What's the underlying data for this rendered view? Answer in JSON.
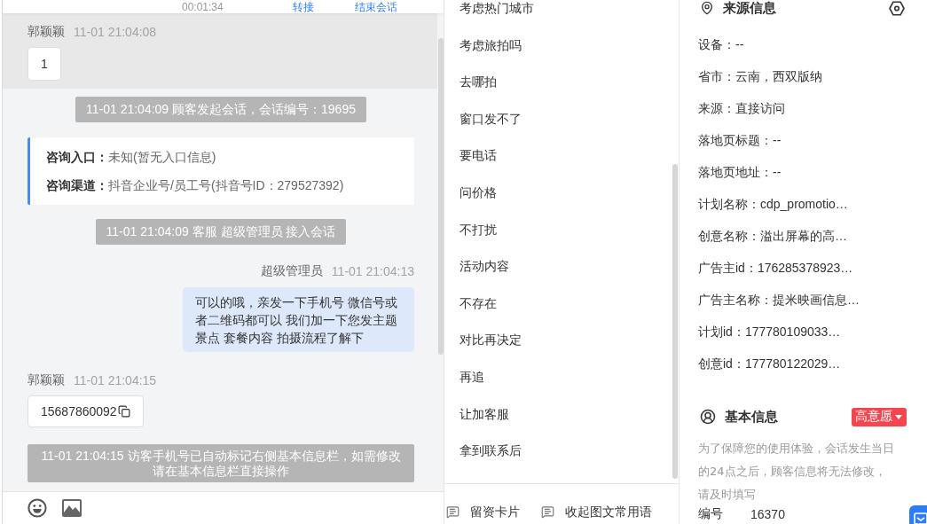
{
  "session_bar": {
    "timer": "00:01:34",
    "actions": [
      "转接",
      "结束会话"
    ]
  },
  "chat": {
    "messages": [
      {
        "kind": "visitor",
        "name": "郭颖颖",
        "time": "11-01 21:04:08",
        "text": "1",
        "copyable": false,
        "highlighted": true
      },
      {
        "kind": "notice",
        "text": "11-01 21:04:09 顾客发起会话，会话编号：19695",
        "highlighted": false
      },
      {
        "kind": "info",
        "lines": [
          "**咨询入口：**未知(暂无入口信息)",
          "**咨询渠道：**抖音企业号/员工号(抖音号ID：279527392)"
        ],
        "highlighted": false
      },
      {
        "kind": "notice",
        "text": "11-01 21:04:09 客服 超级管理员 接入会话",
        "highlighted": false
      },
      {
        "kind": "agent",
        "name": "超级管理员",
        "time": "11-01 21:04:13",
        "text": "可以的哦，亲发一下手机号 微信号或者二维码都可以 我们加一下您发主题景点 套餐内容 拍摄流程了解下",
        "highlighted": false
      },
      {
        "kind": "visitor",
        "name": "郭颖颖",
        "time": "11-01 21:04:15",
        "text": "15687860092",
        "copyable": true,
        "highlighted": false
      },
      {
        "kind": "notice",
        "text": "11-01 21:04:15 访客手机号已自动标记右侧基本信息栏，如需修改请在基本信息栏直接操作",
        "highlighted": false
      }
    ]
  },
  "quick_replies": {
    "items": [
      "考虑热门城市",
      "考虑旅拍吗",
      "去哪拍",
      "窗口发不了",
      "要电话",
      "问价格",
      "不打扰",
      "活动内容",
      "不存在",
      "对比再决定",
      "再追",
      "让加客服",
      "拿到联系后"
    ],
    "toolbar": [
      "留资卡片",
      "收起图文常用语"
    ]
  },
  "source_info": {
    "title": "来源信息",
    "fields": [
      "设备：--",
      "省市：云南，西双版纳",
      "来源：直接访问",
      "落地页标题：--",
      "落地页地址：--",
      "计划名称：cdp_promotio…",
      "创意名称：溢出屏幕的高…",
      "广告主id：176285378923…",
      "广告主名称：提米映画信息…",
      "计划id：177780109033…",
      "创意id：177780122029…"
    ]
  },
  "basic_info": {
    "title": "基本信息",
    "intent": "高意愿",
    "note": "为了保障您的使用体验，会话发生当日的24点之后，顾客信息将无法修改，请及时填写",
    "fields": [
      {
        "label": "编号",
        "value": "16370"
      }
    ]
  }
}
